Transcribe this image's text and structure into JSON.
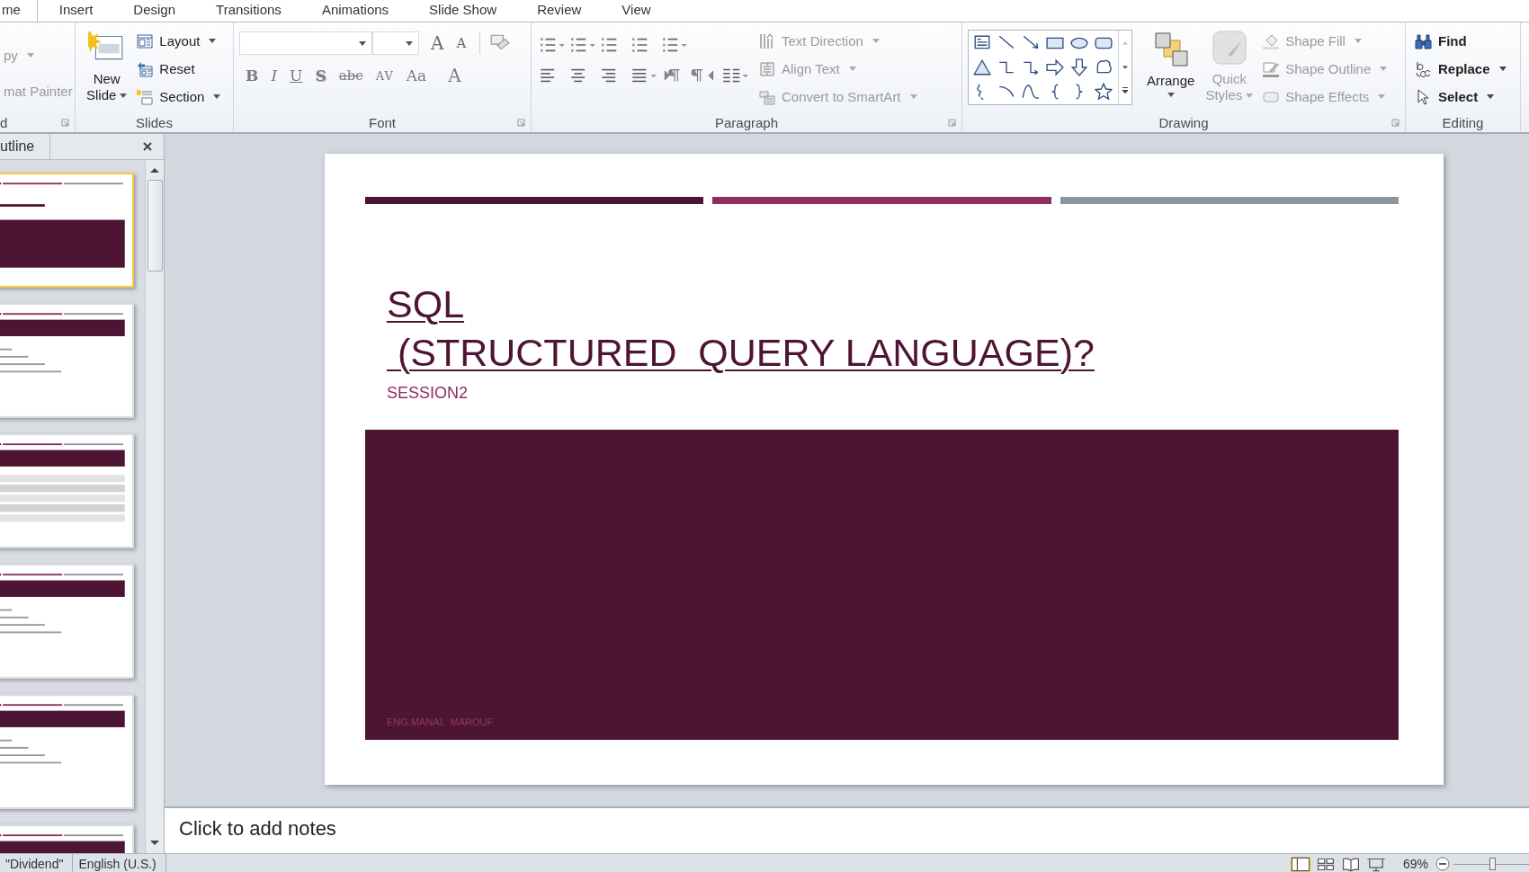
{
  "tabs": [
    {
      "label": "me",
      "selected": true
    },
    {
      "label": "Insert",
      "selected": false
    },
    {
      "label": "Design",
      "selected": false
    },
    {
      "label": "Transitions",
      "selected": false
    },
    {
      "label": "Animations",
      "selected": false
    },
    {
      "label": "Slide Show",
      "selected": false
    },
    {
      "label": "Review",
      "selected": false
    },
    {
      "label": "View",
      "selected": false
    }
  ],
  "ribbon": {
    "clipboard": {
      "label": "d",
      "items": [
        {
          "label": "py",
          "dropdown": true,
          "disabled": true
        },
        {
          "label": "mat Painter",
          "dropdown": false,
          "disabled": true
        }
      ]
    },
    "slides": {
      "label": "Slides",
      "new_slide": [
        "New",
        "Slide"
      ],
      "items": [
        {
          "label": "Layout",
          "dropdown": true
        },
        {
          "label": "Reset",
          "dropdown": false
        },
        {
          "label": "Section",
          "dropdown": true
        }
      ]
    },
    "font": {
      "label": "Font",
      "size_buttons": [
        {
          "text": "A",
          "kind": "grow"
        },
        {
          "text": "A",
          "kind": "shrink"
        }
      ],
      "format_buttons": [
        {
          "text": "B",
          "kind": "bold",
          "disabled": true
        },
        {
          "text": "I",
          "kind": "italic",
          "disabled": true
        },
        {
          "text": "U",
          "kind": "underline",
          "disabled": true
        },
        {
          "text": "S",
          "kind": "shadow",
          "disabled": true
        },
        {
          "text": "abc",
          "kind": "strike",
          "disabled": true
        },
        {
          "text": "AV",
          "kind": "spacing",
          "disabled": true
        },
        {
          "text": "Aa",
          "kind": "case",
          "disabled": true
        },
        {
          "text": "A",
          "kind": "color",
          "disabled": true
        }
      ]
    },
    "paragraph": {
      "label": "Paragraph",
      "commands": [
        {
          "label": "Text Direction",
          "disabled": true
        },
        {
          "label": "Align Text",
          "disabled": true
        },
        {
          "label": "Convert to SmartArt",
          "disabled": true
        }
      ]
    },
    "drawing": {
      "label": "Drawing",
      "arrange": "Arrange",
      "quick_styles": {
        "lines": [
          "Quick",
          "Styles"
        ],
        "disabled": true
      },
      "commands": [
        {
          "label": "Shape Fill",
          "disabled": true
        },
        {
          "label": "Shape Outline",
          "disabled": true
        },
        {
          "label": "Shape Effects",
          "disabled": true
        }
      ]
    },
    "editing": {
      "label": "Editing",
      "commands": [
        {
          "label": "Find",
          "dropdown": false
        },
        {
          "label": "Replace",
          "dropdown": true
        },
        {
          "label": "Select",
          "dropdown": true
        }
      ]
    }
  },
  "outline_pane": {
    "tab": "utline",
    "thumbnails": [
      {
        "kind": "title",
        "selected": true
      },
      {
        "kind": "content",
        "selected": false
      },
      {
        "kind": "table",
        "selected": false
      },
      {
        "kind": "content",
        "selected": false
      },
      {
        "kind": "content",
        "selected": false
      },
      {
        "kind": "content",
        "selected": false
      }
    ]
  },
  "slide": {
    "bars": [
      {
        "color": "#4e1434"
      },
      {
        "color": "#8e2d5e"
      },
      {
        "color": "#8c969f"
      }
    ],
    "title_lines": [
      "SQL",
      " (STRUCTURED  QUERY LANGUAGE)?"
    ],
    "subtitle": "SESSION2",
    "footer": "ENG.MANAL  MAROUF"
  },
  "notes": {
    "placeholder": "Click to add notes"
  },
  "status_bar": {
    "items": [
      "\"Dividend\"",
      "English (U.S.)"
    ],
    "zoom": "69%",
    "zoom_slider": {
      "level": 0.4
    }
  }
}
